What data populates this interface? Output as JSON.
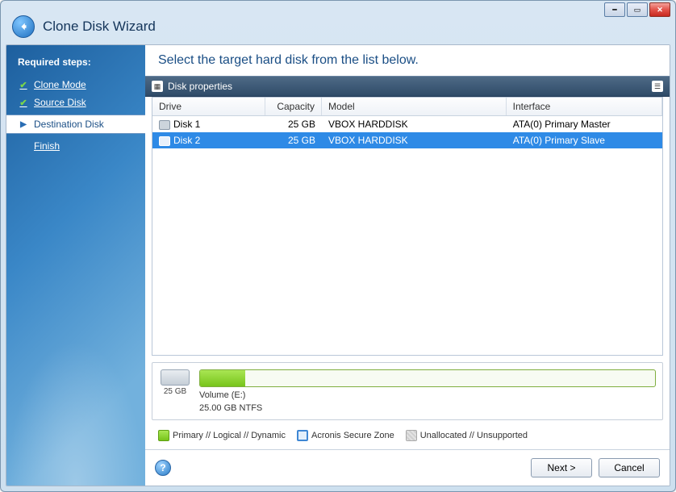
{
  "title": "Clone Disk Wizard",
  "sidebar": {
    "header": "Required steps:",
    "items": [
      {
        "label": "Clone Mode",
        "state": "done"
      },
      {
        "label": "Source Disk",
        "state": "done"
      },
      {
        "label": "Destination Disk",
        "state": "active"
      },
      {
        "label": "Finish",
        "state": "pending"
      }
    ]
  },
  "main": {
    "heading": "Select the target hard disk from the list below.",
    "panel_title": "Disk properties",
    "columns": {
      "drive": "Drive",
      "capacity": "Capacity",
      "model": "Model",
      "interface": "Interface"
    },
    "rows": [
      {
        "drive": "Disk 1",
        "capacity": "25 GB",
        "model": "VBOX HARDDISK",
        "interface": "ATA(0) Primary Master",
        "selected": false
      },
      {
        "drive": "Disk 2",
        "capacity": "25 GB",
        "model": "VBOX HARDDISK",
        "interface": "ATA(0) Primary Slave",
        "selected": true
      }
    ],
    "volume": {
      "size_label": "25 GB",
      "name": "Volume (E:)",
      "detail": "25.00 GB  NTFS",
      "fill_pct": 10
    },
    "legend": {
      "primary": "Primary // Logical // Dynamic",
      "secure": "Acronis Secure Zone",
      "unalloc": "Unallocated // Unsupported"
    }
  },
  "footer": {
    "next": "Next >",
    "cancel": "Cancel"
  }
}
